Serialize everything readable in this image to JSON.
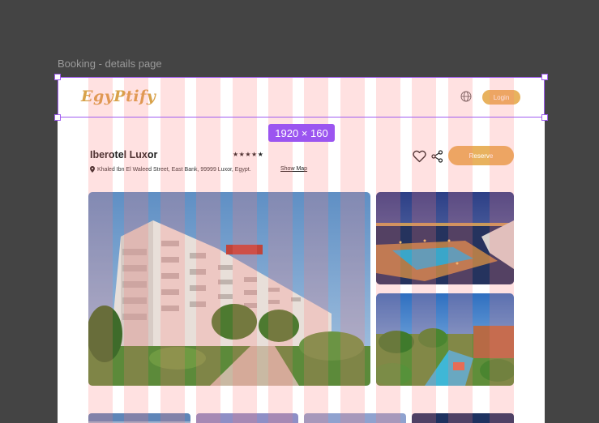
{
  "canvas": {
    "frame_title": "Booking - details page",
    "selection_dimensions": "1920 × 160"
  },
  "header": {
    "logo_text": "EgyPtify",
    "language_icon": "globe-icon",
    "login_label": "Login"
  },
  "hotel": {
    "name": "Iberotel Luxor",
    "rating_stars": "★★★★★",
    "address": "Khaled Ibn El Waleed Street, East Bank, 99999 Luxor, Egypt.",
    "show_map_label": "Show Map",
    "favorite_icon": "heart-icon",
    "share_icon": "share-icon",
    "reserve_label": "Reserve"
  },
  "gallery": {
    "main": "hotel-building-photo",
    "side_top": "nile-pool-deck-photo",
    "side_bottom": "resort-pool-palms-photo",
    "thumbnails": [
      "thumbnail-1",
      "thumbnail-2",
      "thumbnail-3",
      "thumbnail-4"
    ]
  },
  "colors": {
    "accent": "#e8b25e",
    "selection": "#9b55f0",
    "grid_overlay": "#ff7878",
    "canvas_bg": "#444444"
  }
}
